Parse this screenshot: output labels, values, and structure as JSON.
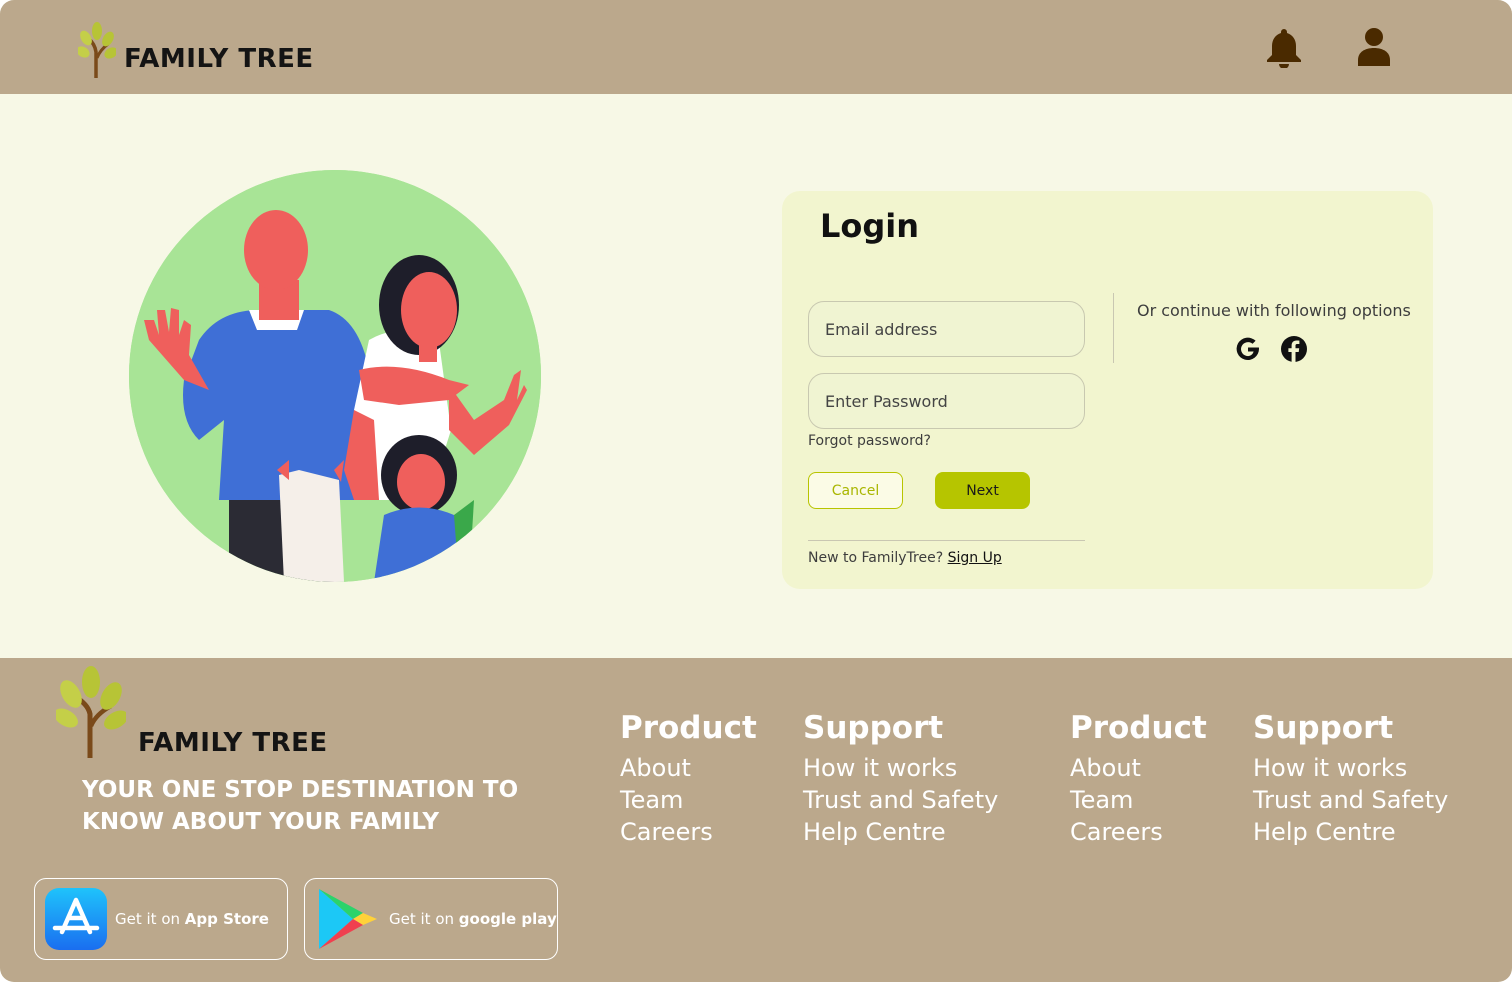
{
  "header": {
    "brand": "FAMILY TREE",
    "icons": [
      "tree-logo-icon",
      "bell-icon",
      "user-icon"
    ]
  },
  "login": {
    "title": "Login",
    "email_placeholder": "Email address",
    "password_placeholder": "Enter Password",
    "forgot": "Forgot password?",
    "cancel": "Cancel",
    "next": "Next",
    "new_prompt": "New to FamilyTree?",
    "signup": "Sign Up",
    "continue_text": "Or continue with following options",
    "social_icons": [
      "google-icon",
      "facebook-icon"
    ]
  },
  "footer": {
    "brand": "FAMILY TREE",
    "tagline": "YOUR ONE STOP DESTINATION TO KNOW ABOUT YOUR FAMILY",
    "columns": [
      {
        "heading": "Product",
        "links": [
          "About",
          "Team",
          "Careers"
        ]
      },
      {
        "heading": "Support",
        "links": [
          "How it works",
          "Trust and Safety",
          "Help Centre"
        ]
      },
      {
        "heading": "Product",
        "links": [
          "About",
          "Team",
          "Careers"
        ]
      },
      {
        "heading": "Support",
        "links": [
          "How it works",
          "Trust and Safety",
          "Help Centre"
        ]
      }
    ],
    "stores": [
      {
        "prefix": "Get it on",
        "name": "App Store"
      },
      {
        "prefix": "Get it on",
        "name": "google play"
      }
    ]
  },
  "colors": {
    "header_bg": "#bba88c",
    "page_bg": "#f7f8e6",
    "card_bg": "#f2f5cf",
    "accent": "#b6c500",
    "icon_brown": "#4a2a00"
  }
}
